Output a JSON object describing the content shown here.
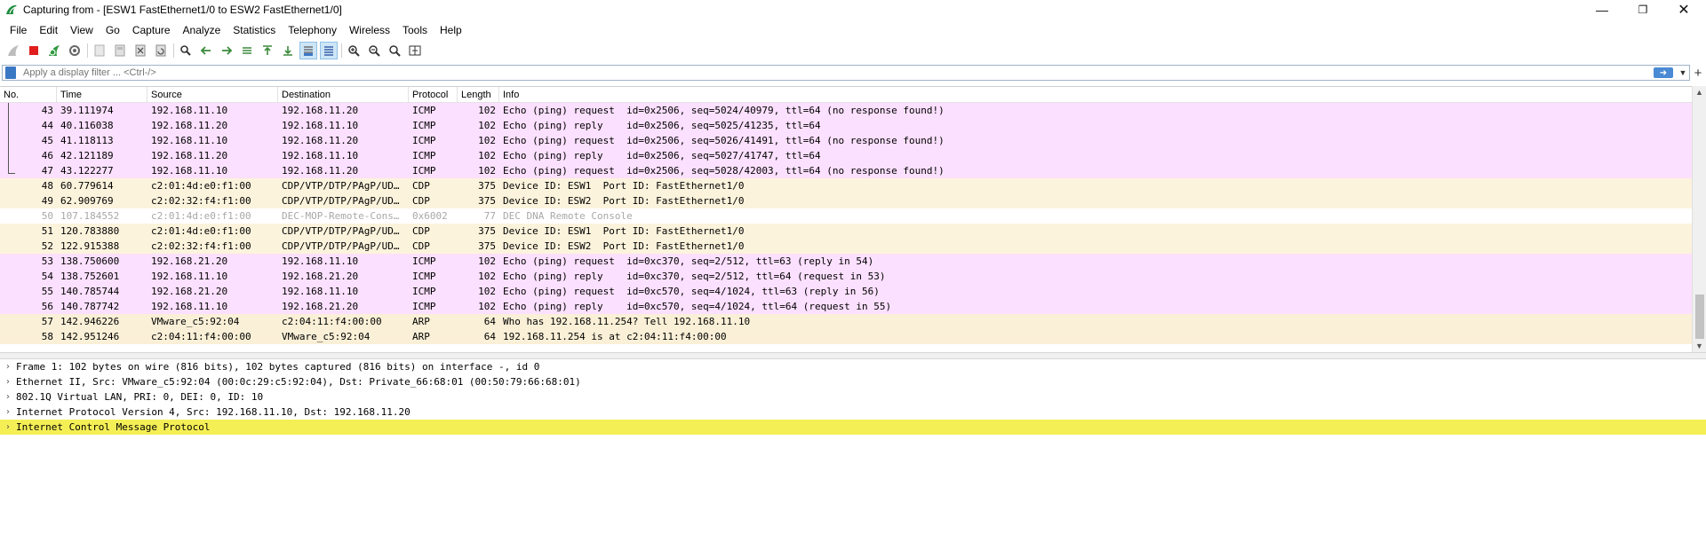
{
  "window": {
    "title": "Capturing from - [ESW1 FastEthernet1/0 to ESW2 FastEthernet1/0]",
    "controls": [
      "minimize",
      "restore",
      "close"
    ]
  },
  "menu": [
    "File",
    "Edit",
    "View",
    "Go",
    "Capture",
    "Analyze",
    "Statistics",
    "Telephony",
    "Wireless",
    "Tools",
    "Help"
  ],
  "toolbar": {
    "icons": [
      "shark-fin-start-icon",
      "stop-capture-icon",
      "restart-capture-icon",
      "capture-options-icon",
      "open-file-icon",
      "save-file-icon",
      "close-file-icon",
      "reload-file-icon",
      "find-packet-icon",
      "go-back-icon",
      "go-forward-icon",
      "go-to-packet-icon",
      "go-first-icon",
      "go-last-icon",
      "auto-scroll-icon",
      "colorize-icon",
      "zoom-in-icon",
      "zoom-out-icon",
      "normal-size-icon",
      "resize-columns-icon"
    ]
  },
  "filter": {
    "placeholder": "Apply a display filter ... <Ctrl-/>"
  },
  "columns": [
    "No.",
    "Time",
    "Source",
    "Destination",
    "Protocol",
    "Length",
    "Info"
  ],
  "packets": [
    {
      "no": "43",
      "time": "39.111974",
      "src": "192.168.11.10",
      "dst": "192.168.11.20",
      "proto": "ICMP",
      "len": "102",
      "info": "Echo (ping) request  id=0x2506, seq=5024/40979, ttl=64 (no response found!)",
      "kind": "icmp"
    },
    {
      "no": "44",
      "time": "40.116038",
      "src": "192.168.11.20",
      "dst": "192.168.11.10",
      "proto": "ICMP",
      "len": "102",
      "info": "Echo (ping) reply    id=0x2506, seq=5025/41235, ttl=64",
      "kind": "icmp"
    },
    {
      "no": "45",
      "time": "41.118113",
      "src": "192.168.11.10",
      "dst": "192.168.11.20",
      "proto": "ICMP",
      "len": "102",
      "info": "Echo (ping) request  id=0x2506, seq=5026/41491, ttl=64 (no response found!)",
      "kind": "icmp"
    },
    {
      "no": "46",
      "time": "42.121189",
      "src": "192.168.11.20",
      "dst": "192.168.11.10",
      "proto": "ICMP",
      "len": "102",
      "info": "Echo (ping) reply    id=0x2506, seq=5027/41747, ttl=64",
      "kind": "icmp"
    },
    {
      "no": "47",
      "time": "43.122277",
      "src": "192.168.11.10",
      "dst": "192.168.11.20",
      "proto": "ICMP",
      "len": "102",
      "info": "Echo (ping) request  id=0x2506, seq=5028/42003, ttl=64 (no response found!)",
      "kind": "icmp"
    },
    {
      "no": "48",
      "time": "60.779614",
      "src": "c2:01:4d:e0:f1:00",
      "dst": "CDP/VTP/DTP/PAgP/UD…",
      "proto": "CDP",
      "len": "375",
      "info": "Device ID: ESW1  Port ID: FastEthernet1/0",
      "kind": "cdp"
    },
    {
      "no": "49",
      "time": "62.909769",
      "src": "c2:02:32:f4:f1:00",
      "dst": "CDP/VTP/DTP/PAgP/UD…",
      "proto": "CDP",
      "len": "375",
      "info": "Device ID: ESW2  Port ID: FastEthernet1/0",
      "kind": "cdp"
    },
    {
      "no": "50",
      "time": "107.184552",
      "src": "c2:01:4d:e0:f1:00",
      "dst": "DEC-MOP-Remote-Cons…",
      "proto": "0x6002",
      "len": "77",
      "info": "DEC DNA Remote Console",
      "kind": "dec"
    },
    {
      "no": "51",
      "time": "120.783880",
      "src": "c2:01:4d:e0:f1:00",
      "dst": "CDP/VTP/DTP/PAgP/UD…",
      "proto": "CDP",
      "len": "375",
      "info": "Device ID: ESW1  Port ID: FastEthernet1/0",
      "kind": "cdp"
    },
    {
      "no": "52",
      "time": "122.915388",
      "src": "c2:02:32:f4:f1:00",
      "dst": "CDP/VTP/DTP/PAgP/UD…",
      "proto": "CDP",
      "len": "375",
      "info": "Device ID: ESW2  Port ID: FastEthernet1/0",
      "kind": "cdp"
    },
    {
      "no": "53",
      "time": "138.750600",
      "src": "192.168.21.20",
      "dst": "192.168.11.10",
      "proto": "ICMP",
      "len": "102",
      "info": "Echo (ping) request  id=0xc370, seq=2/512, ttl=63 (reply in 54)",
      "kind": "icmp"
    },
    {
      "no": "54",
      "time": "138.752601",
      "src": "192.168.11.10",
      "dst": "192.168.21.20",
      "proto": "ICMP",
      "len": "102",
      "info": "Echo (ping) reply    id=0xc370, seq=2/512, ttl=64 (request in 53)",
      "kind": "icmp"
    },
    {
      "no": "55",
      "time": "140.785744",
      "src": "192.168.21.20",
      "dst": "192.168.11.10",
      "proto": "ICMP",
      "len": "102",
      "info": "Echo (ping) request  id=0xc570, seq=4/1024, ttl=63 (reply in 56)",
      "kind": "icmp"
    },
    {
      "no": "56",
      "time": "140.787742",
      "src": "192.168.11.10",
      "dst": "192.168.21.20",
      "proto": "ICMP",
      "len": "102",
      "info": "Echo (ping) reply    id=0xc570, seq=4/1024, ttl=64 (request in 55)",
      "kind": "icmp"
    },
    {
      "no": "57",
      "time": "142.946226",
      "src": "VMware_c5:92:04",
      "dst": "c2:04:11:f4:00:00",
      "proto": "ARP",
      "len": "64",
      "info": "Who has 192.168.11.254? Tell 192.168.11.10",
      "kind": "arp"
    },
    {
      "no": "58",
      "time": "142.951246",
      "src": "c2:04:11:f4:00:00",
      "dst": "VMware_c5:92:04",
      "proto": "ARP",
      "len": "64",
      "info": "192.168.11.254 is at c2:04:11:f4:00:00",
      "kind": "arp"
    }
  ],
  "details": [
    {
      "text": "Frame 1: 102 bytes on wire (816 bits), 102 bytes captured (816 bits) on interface -, id 0",
      "highlight": false
    },
    {
      "text": "Ethernet II, Src: VMware_c5:92:04 (00:0c:29:c5:92:04), Dst: Private_66:68:01 (00:50:79:66:68:01)",
      "highlight": false
    },
    {
      "text": "802.1Q Virtual LAN, PRI: 0, DEI: 0, ID: 10",
      "highlight": false
    },
    {
      "text": "Internet Protocol Version 4, Src: 192.168.11.10, Dst: 192.168.11.20",
      "highlight": false
    },
    {
      "text": "Internet Control Message Protocol",
      "highlight": true
    }
  ],
  "colors": {
    "icmp_row": "#fce0ff",
    "cdp_row": "#fcf3dc",
    "arp_row": "#faf0d7",
    "highlight": "#f5ef56",
    "accent": "#3b78c4"
  }
}
